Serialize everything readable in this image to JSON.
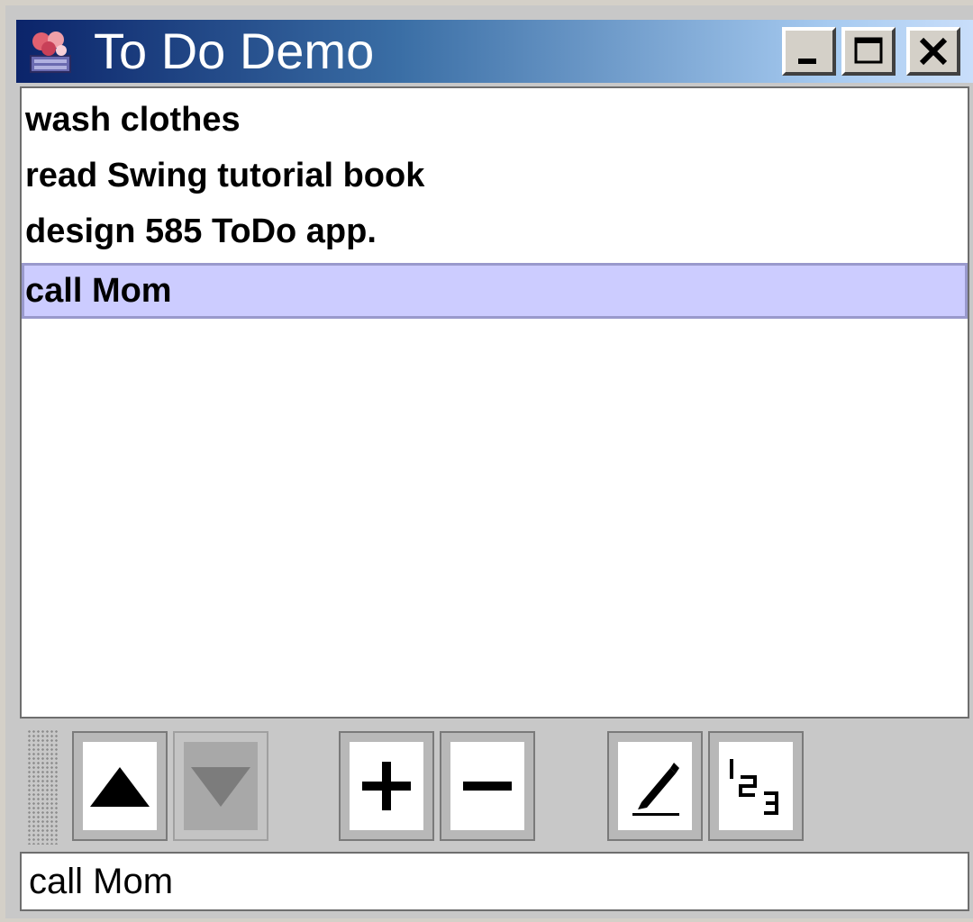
{
  "window": {
    "title": "To Do Demo",
    "controls": [
      {
        "name": "minimize-button",
        "icon": "minimize-icon"
      },
      {
        "name": "maximize-button",
        "icon": "maximize-icon"
      },
      {
        "name": "close-button",
        "icon": "close-icon"
      }
    ]
  },
  "todo_list": {
    "items": [
      {
        "label": "wash clothes",
        "selected": false
      },
      {
        "label": "read Swing tutorial book",
        "selected": false
      },
      {
        "label": "design 585 ToDo app.",
        "selected": false
      },
      {
        "label": "call Mom",
        "selected": true
      }
    ],
    "selection_color": "#ccccff"
  },
  "toolbar": {
    "buttons": [
      {
        "name": "move-up-button",
        "icon": "arrow-up-icon",
        "enabled": true
      },
      {
        "name": "move-down-button",
        "icon": "arrow-down-icon",
        "enabled": false
      },
      {
        "name": "add-button",
        "icon": "plus-icon",
        "enabled": true
      },
      {
        "name": "remove-button",
        "icon": "minus-icon",
        "enabled": true
      },
      {
        "name": "edit-button",
        "icon": "pencil-icon",
        "enabled": true
      },
      {
        "name": "number-button",
        "icon": "numbering-icon",
        "enabled": true
      }
    ]
  },
  "input": {
    "value": "call Mom"
  },
  "colors": {
    "titlebar_start": "#0b246a",
    "titlebar_end": "#c9defa",
    "toolbar_bg": "#c8c8c8"
  }
}
